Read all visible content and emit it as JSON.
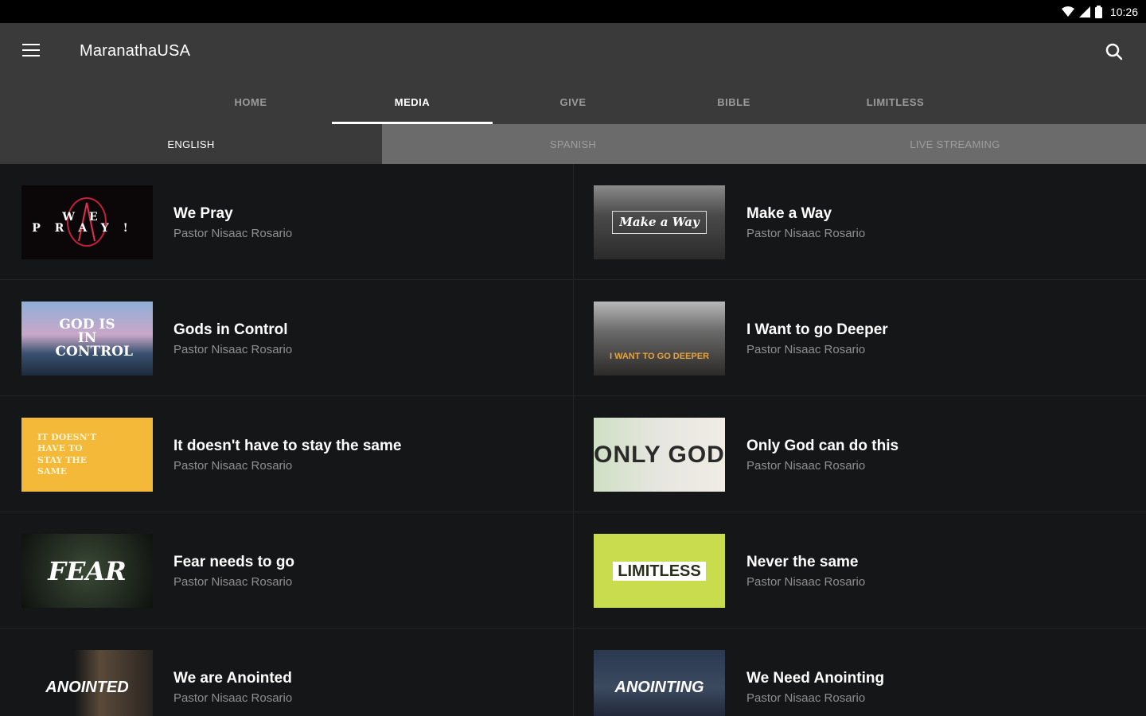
{
  "status": {
    "time": "10:26"
  },
  "app": {
    "title": "MaranathaUSA"
  },
  "tabs": [
    {
      "label": "HOME"
    },
    {
      "label": "MEDIA"
    },
    {
      "label": "GIVE"
    },
    {
      "label": "BIBLE"
    },
    {
      "label": "LIMITLESS"
    }
  ],
  "sub_tabs": [
    {
      "label": "ENGLISH"
    },
    {
      "label": "SPANISH"
    },
    {
      "label": "LIVE STREAMING"
    }
  ],
  "media_left": [
    {
      "title": "We Pray",
      "speaker": "Pastor Nisaac Rosario",
      "thumb_text": "WE PRAY!"
    },
    {
      "title": "Gods in Control",
      "speaker": "Pastor Nisaac Rosario",
      "thumb_text": "GOD IS IN CONTROL"
    },
    {
      "title": "It doesn't have to stay the same",
      "speaker": "Pastor Nisaac Rosario",
      "thumb_text": "IT DOESN'T HAVE TO STAY THE SAME"
    },
    {
      "title": "Fear needs to go",
      "speaker": "Pastor Nisaac Rosario",
      "thumb_text": "FEAR"
    },
    {
      "title": "We are Anointed",
      "speaker": "Pastor Nisaac Rosario",
      "thumb_text": "ANOINTED"
    }
  ],
  "media_right": [
    {
      "title": "Make a Way",
      "speaker": "Pastor Nisaac Rosario",
      "thumb_text": "Make a Way"
    },
    {
      "title": "I Want to go Deeper",
      "speaker": "Pastor Nisaac Rosario",
      "thumb_text": "I WANT TO GO DEEPER"
    },
    {
      "title": "Only God can do this",
      "speaker": "Pastor Nisaac Rosario",
      "thumb_text": "ONLY GOD"
    },
    {
      "title": "Never the same",
      "speaker": "Pastor Nisaac Rosario",
      "thumb_text": "LIMITLESS"
    },
    {
      "title": "We Need Anointing",
      "speaker": "Pastor Nisaac Rosario",
      "thumb_text": "ANOINTING"
    }
  ]
}
